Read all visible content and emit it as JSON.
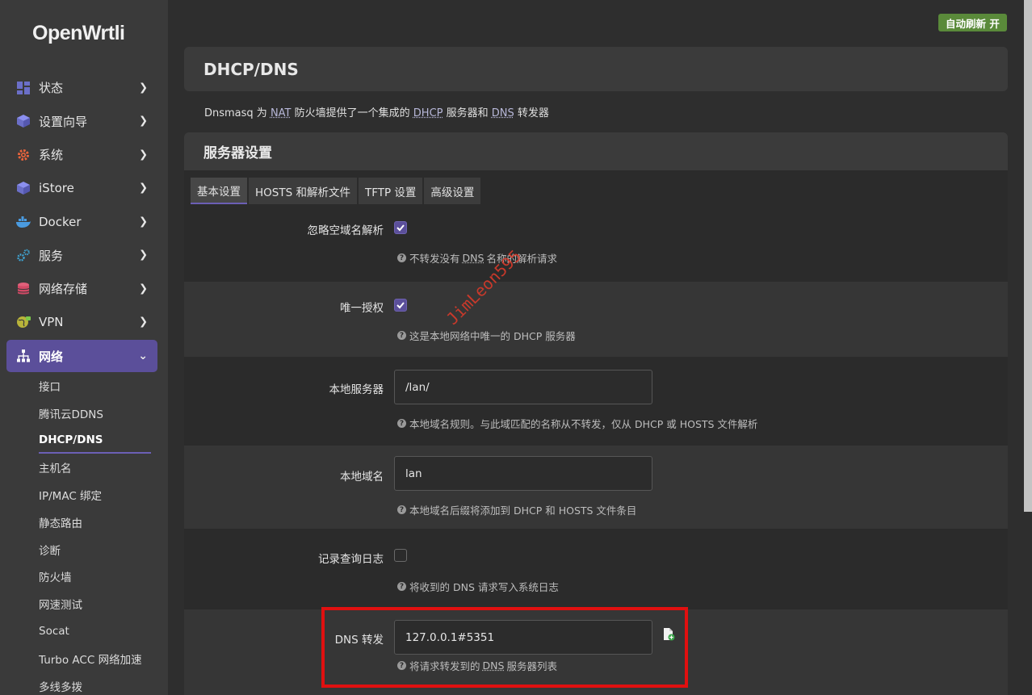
{
  "brand": {
    "logo": "OpenWrtli"
  },
  "badge": {
    "label": "自动刷新 开"
  },
  "sidebar": {
    "items": [
      {
        "label": "状态",
        "icon": "dashboard-icon"
      },
      {
        "label": "设置向导",
        "icon": "cube-icon"
      },
      {
        "label": "系统",
        "icon": "gear-icon"
      },
      {
        "label": "iStore",
        "icon": "cube-icon"
      },
      {
        "label": "Docker",
        "icon": "docker-icon"
      },
      {
        "label": "服务",
        "icon": "cogs-icon"
      },
      {
        "label": "网络存储",
        "icon": "database-icon"
      },
      {
        "label": "VPN",
        "icon": "globe-lock-icon"
      },
      {
        "label": "网络",
        "icon": "network-icon"
      }
    ],
    "subitems": [
      "接口",
      "腾讯云DDNS",
      "DHCP/DNS",
      "主机名",
      "IP/MAC 绑定",
      "静态路由",
      "诊断",
      "防火墙",
      "网速测试",
      "Socat",
      "Turbo ACC 网络加速",
      "多线多拨"
    ]
  },
  "page": {
    "title": "DHCP/DNS",
    "desc": {
      "p1": "Dnsmasq 为 ",
      "a1": "NAT",
      "p2": " 防火墙提供了一个集成的 ",
      "a2": "DHCP",
      "p3": " 服务器和 ",
      "a3": "DNS",
      "p4": " 转发器"
    }
  },
  "section": {
    "title": "服务器设置",
    "tabs": [
      "基本设置",
      "HOSTS 和解析文件",
      "TFTP 设置",
      "高级设置"
    ]
  },
  "fields": {
    "domainneeded": {
      "label": "忽略空域名解析",
      "checked": true,
      "hint_p1": "不转发没有",
      "hint_abbr": "DNS",
      "hint_p2": "名称的解析请求"
    },
    "authoritative": {
      "label": "唯一授权",
      "checked": true,
      "hint": "这是本地网络中唯一的 DHCP 服务器"
    },
    "local": {
      "label": "本地服务器",
      "value": "/lan/",
      "hint": "本地域名规则。与此域匹配的名称从不转发，仅从 DHCP 或 HOSTS 文件解析"
    },
    "domain": {
      "label": "本地域名",
      "value": "lan",
      "hint": "本地域名后缀将添加到 DHCP 和 HOSTS 文件条目"
    },
    "logqueries": {
      "label": "记录查询日志",
      "checked": false,
      "hint": "将收到的 DNS 请求写入系统日志"
    },
    "server": {
      "label": "DNS 转发",
      "value": "127.0.0.1#5351",
      "hint_p1": "将请求转发到的",
      "hint_abbr": "DNS",
      "hint_p2": "服务器列表"
    }
  },
  "watermark": "JimLeon595",
  "colors": {
    "accent": "#5b4f9a",
    "badge": "#5a8a3a",
    "highlight": "#e01010"
  }
}
